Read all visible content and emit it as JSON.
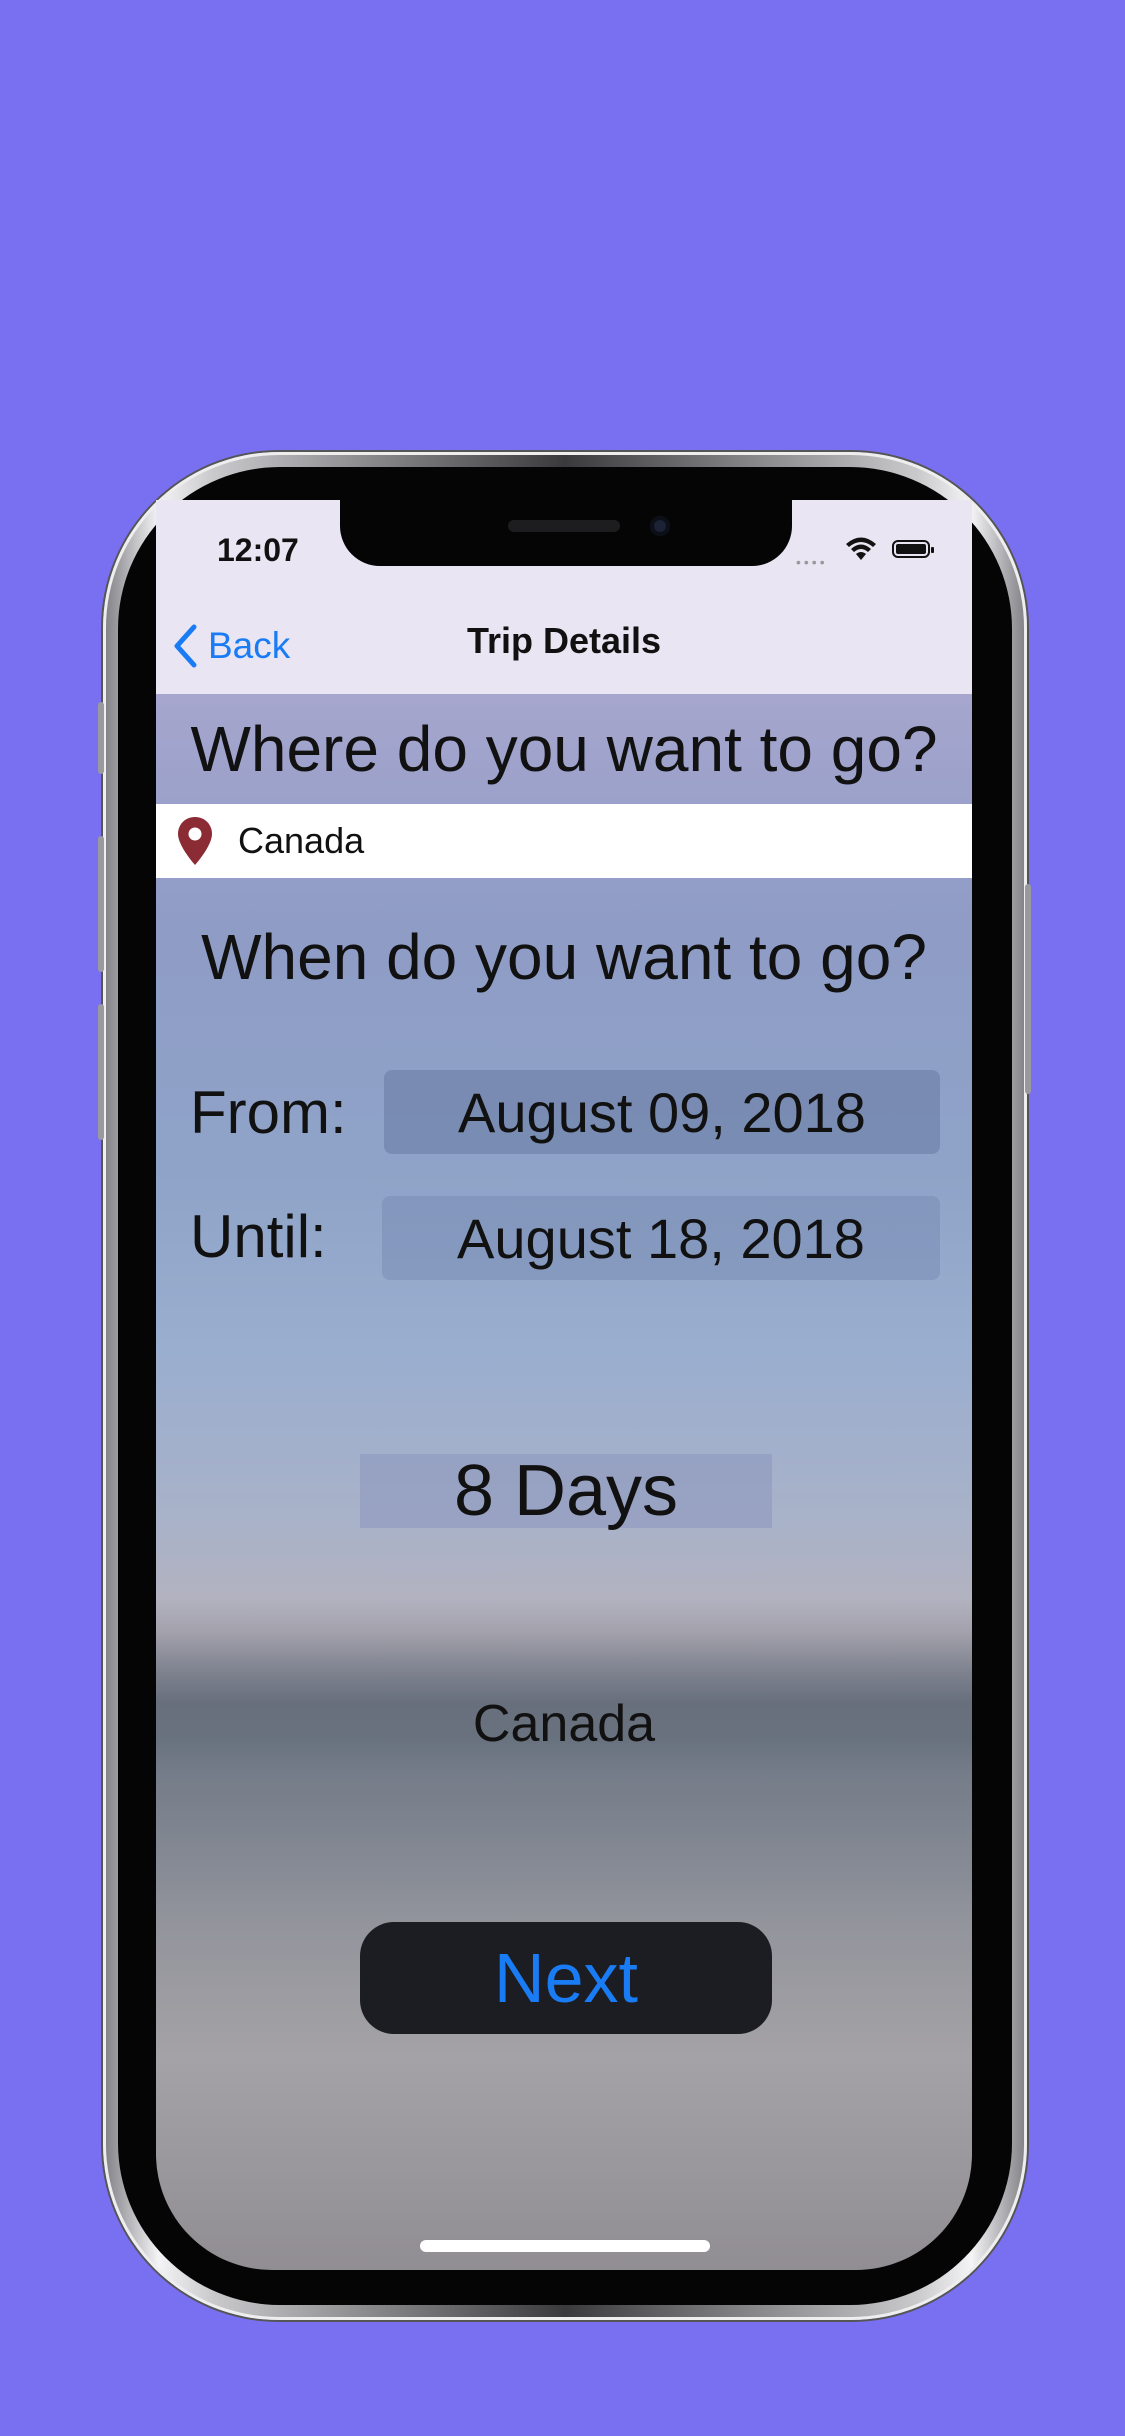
{
  "status_bar": {
    "time": "12:07"
  },
  "nav": {
    "back_label": "Back",
    "title": "Trip Details"
  },
  "destination": {
    "question": "Where do you want to go?",
    "value": "Canada",
    "icon": "map-pin-icon",
    "pin_color": "#8b2b33"
  },
  "dates": {
    "question": "When do you want to go?",
    "from_label": "From:",
    "from_value": "August 09, 2018",
    "until_label": "Until:",
    "until_value": "August 18, 2018"
  },
  "summary": {
    "days": "8 Days",
    "destination_label": "Canada"
  },
  "actions": {
    "next_label": "Next"
  },
  "colors": {
    "background": "#7870f0",
    "accent": "#1a7cf5",
    "button_bg": "#1c1d22"
  }
}
